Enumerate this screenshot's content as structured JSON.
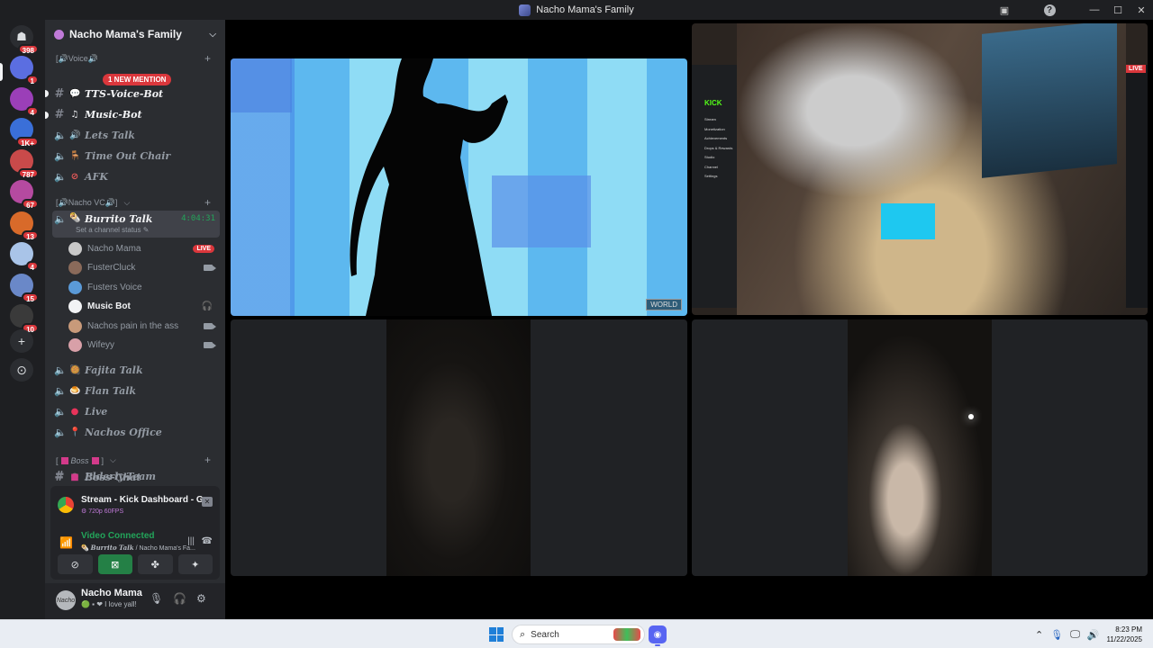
{
  "window": {
    "title": "Nacho Mama's Family"
  },
  "rail": {
    "home_badge": "398",
    "servers": [
      {
        "badge": "1",
        "color": "#5b6ee1"
      },
      {
        "badge": "4",
        "color": "#9b3fb8"
      },
      {
        "badge": "1K+",
        "color": "#3a6fd8"
      },
      {
        "badge": "787",
        "color": "#c94a4a"
      },
      {
        "badge": "67",
        "color": "#b54aa0"
      },
      {
        "badge": "13",
        "color": "#d86a2a"
      },
      {
        "badge": "4",
        "color": "#a9c4e8"
      },
      {
        "badge": "15",
        "color": "#6a88c8"
      },
      {
        "badge": "10",
        "color": "#3a3a3a"
      }
    ]
  },
  "guild": {
    "name": "Nacho Mama's Family"
  },
  "categories": {
    "voice": "[🔊Voice🔊",
    "nacho_vc": "[🔊Nacho VC🔊]",
    "boss": "Boss"
  },
  "mention_badge": "1 NEW MENTION",
  "channels": {
    "tts": "TTS-Voice-Bot",
    "music": "Music-Bot",
    "lets_talk": "Lets Talk",
    "timeout": "Time Out Chair",
    "afk": "AFK",
    "burrito": "Burrito Talk",
    "burrito_time": "4:04:31",
    "burrito_status": "Set a channel status ✎",
    "fajita": "Fajita Talk",
    "flan": "Flan Talk",
    "live": "Live",
    "office": "Nachos Office",
    "elderly": "Elderly-Team",
    "boss_chat": "Boss-Chat"
  },
  "voice_users": [
    {
      "name": "Nacho Mama",
      "tag": "LIVE",
      "color": "#c9c9c9"
    },
    {
      "name": "FusterCluck",
      "tag": "cam",
      "color": "#8a6a5a"
    },
    {
      "name": "Fusters Voice",
      "tag": "",
      "color": "#5a9ad8"
    },
    {
      "name": "Music Bot",
      "tag": "deaf",
      "color": "#f2f3f5"
    },
    {
      "name": "Nachos pain in the ass",
      "tag": "cam",
      "color": "#c89a7a"
    },
    {
      "name": "Wifeyy",
      "tag": "cam",
      "color": "#d8a0a8"
    }
  ],
  "stream_panel": {
    "title": "Stream - Kick Dashboard - Google ...",
    "quality": "⚙ 720p 60FPS"
  },
  "voice_panel": {
    "status": "Video Connected",
    "channel": "Burrito Talk",
    "server": " / Nacho Mama's Fa..."
  },
  "user_panel": {
    "name": "Nacho Mama",
    "status": "I love yall!",
    "avatar_text": "Nacho"
  },
  "video": {
    "watermark": "WORLD",
    "kick_logo": "KICK",
    "kick_menu": [
      "Stream",
      "Monetization",
      "Achievements",
      "Drops & Rewards",
      "Studio",
      "Channel",
      "Settings"
    ],
    "live": "LIVE"
  },
  "taskbar": {
    "search_placeholder": "Search",
    "time": "8:23 PM",
    "date": "11/22/2025"
  }
}
